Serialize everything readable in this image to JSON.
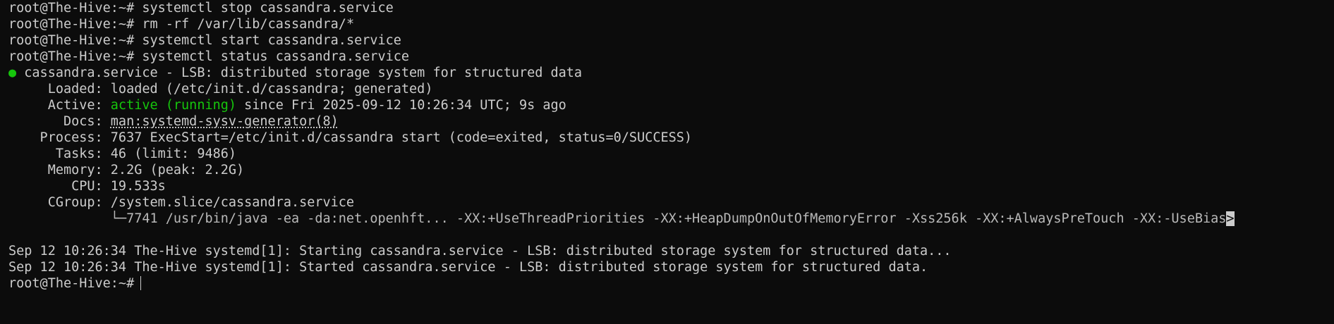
{
  "terminal": {
    "prompt": "root@The-Hive:~#",
    "commands": [
      "systemctl stop cassandra.service",
      "rm -rf /var/lib/cassandra/*",
      "systemctl start cassandra.service",
      "systemctl status cassandra.service"
    ],
    "status": {
      "bullet": "●",
      "header": "cassandra.service - LSB: distributed storage system for structured data",
      "loaded_label": "     Loaded:",
      "loaded_value": "loaded (/etc/init.d/cassandra; generated)",
      "active_label": "     Active:",
      "active_state": "active (running)",
      "active_rest": "since Fri 2025-09-12 10:26:34 UTC; 9s ago",
      "docs_label": "       Docs:",
      "docs_value": "man:systemd-sysv-generator(8)",
      "process_label": "    Process:",
      "process_value": "7637 ExecStart=/etc/init.d/cassandra start (code=exited, status=0/SUCCESS)",
      "tasks_label": "      Tasks:",
      "tasks_value": "46 (limit: 9486)",
      "memory_label": "     Memory:",
      "memory_value": "2.2G (peak: 2.2G)",
      "cpu_label": "        CPU:",
      "cpu_value": "19.533s",
      "cgroup_label": "     CGroup:",
      "cgroup_value": "/system.slice/cassandra.service",
      "cgroup_child": "             └─7741 /usr/bin/java -ea -da:net.openhft... -XX:+UseThreadPriorities -XX:+HeapDumpOnOutOfMemoryError -Xss256k -XX:+AlwaysPreTouch -XX:-UseBias",
      "truncation_marker": ">"
    },
    "log_lines": [
      "Sep 12 10:26:34 The-Hive systemd[1]: Starting cassandra.service - LSB: distributed storage system for structured data...",
      "Sep 12 10:26:34 The-Hive systemd[1]: Started cassandra.service - LSB: distributed storage system for structured data."
    ]
  }
}
